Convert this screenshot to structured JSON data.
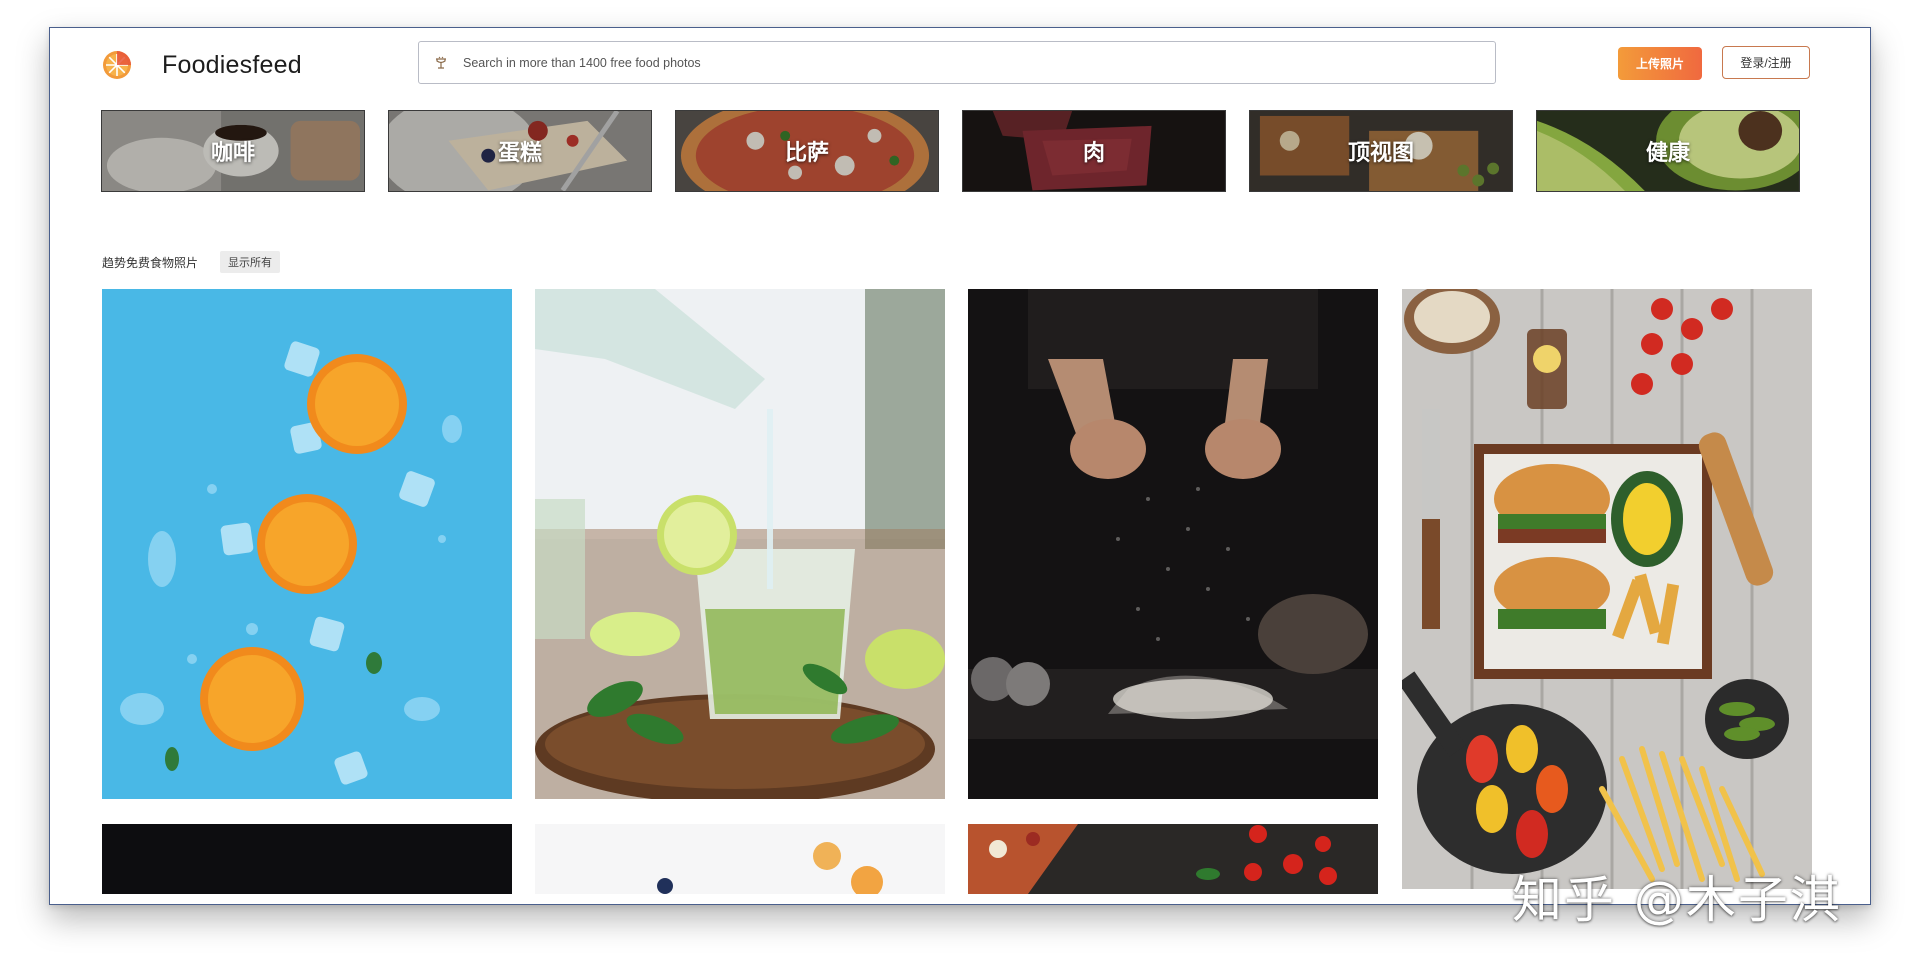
{
  "header": {
    "brand": "Foodiesfeed",
    "search_placeholder": "Search in more than 1400 free food photos",
    "upload_label": "上传照片",
    "login_label": "登录/注册"
  },
  "categories": [
    {
      "label": "咖啡",
      "icon": "coffee"
    },
    {
      "label": "蛋糕",
      "icon": "cake"
    },
    {
      "label": "比萨",
      "icon": "pizza"
    },
    {
      "label": "肉",
      "icon": "meat"
    },
    {
      "label": "顶视图",
      "icon": "top-view"
    },
    {
      "label": "健康",
      "icon": "healthy"
    }
  ],
  "trending": {
    "title": "趋势免费食物照片",
    "show_all_label": "显示所有"
  },
  "photos": [
    {
      "subject": "orange slices and ice on blue"
    },
    {
      "subject": "pouring mojito with lime"
    },
    {
      "subject": "flour dust hands dark"
    },
    {
      "subject": "burger and fries top view"
    },
    {
      "subject": "dark photo"
    },
    {
      "subject": "light food photo"
    },
    {
      "subject": "pizza and tomatoes"
    }
  ],
  "watermark": "知乎 @木子淇",
  "colors": {
    "accent_start": "#f39b3a",
    "accent_end": "#f0693f",
    "window_border": "#4a5f8c"
  }
}
